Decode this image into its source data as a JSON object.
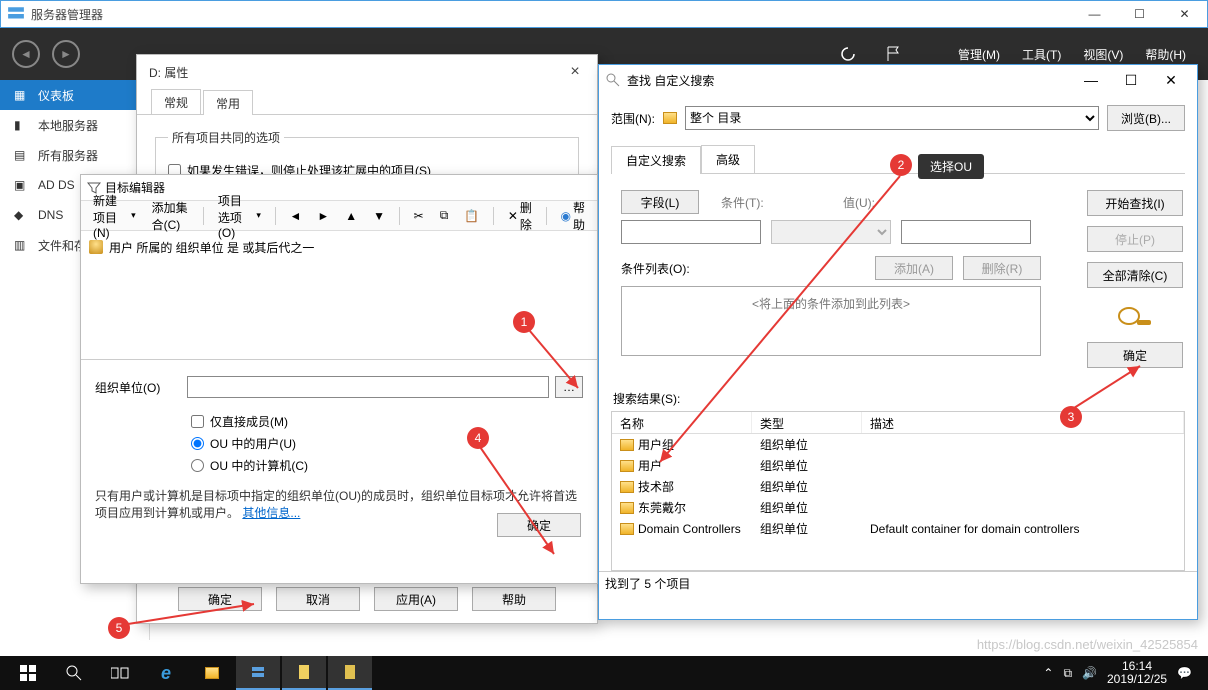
{
  "server_manager": {
    "title": "服务器管理器",
    "menu": {
      "manage": "管理(M)",
      "tools": "工具(T)",
      "view": "视图(V)",
      "help": "帮助(H)"
    },
    "sidebar": {
      "items": [
        {
          "label": "仪表板"
        },
        {
          "label": "本地服务器"
        },
        {
          "label": "所有服务器"
        },
        {
          "label": "AD DS"
        },
        {
          "label": "DNS"
        },
        {
          "label": "文件和存储"
        }
      ]
    }
  },
  "props_dialog": {
    "title": "D: 属性",
    "tabs": {
      "t1": "常规",
      "t2": "常用"
    },
    "group_label": "所有项目共同的选项",
    "checkbox": "如果发生错误，则停止处理该扩展中的项目(S)",
    "buttons": {
      "ok": "确定",
      "cancel": "取消",
      "apply": "应用(A)",
      "help": "帮助"
    }
  },
  "target_editor": {
    "title": "目标编辑器",
    "toolbar": {
      "new_item": "新建项目(N)",
      "add_set": "添加集合(C)",
      "options": "项目选项(O)",
      "delete": "删除",
      "help": "帮助"
    },
    "rule_text": "用户 所属的 组织单位 是  或其后代之一",
    "ou_label": "组织单位(O)",
    "direct_members": "仅直接成员(M)",
    "users_in_ou": "OU 中的用户(U)",
    "computers_in_ou": "OU 中的计算机(C)",
    "note": "只有用户或计算机是目标项中指定的组织单位(OU)的成员时，组织单位目标项才允许将首选项目应用到计算机或用户。",
    "other_info": "其他信息...",
    "ok": "确定"
  },
  "find_dialog": {
    "title": "查找 自定义搜索",
    "scope_label": "范围(N):",
    "scope_value": "整个 目录",
    "browse": "浏览(B)...",
    "tabs": {
      "custom": "自定义搜索",
      "advanced": "高级"
    },
    "field_btn": "字段(L)",
    "cond_label": "条件(T):",
    "value_label": "值(U):",
    "list_label": "条件列表(O):",
    "add": "添加(A)",
    "remove": "删除(R)",
    "placeholder": "<将上面的条件添加到此列表>",
    "start": "开始查找(I)",
    "stop": "停止(P)",
    "clear": "全部清除(C)",
    "ok_btn": "确定",
    "results_label": "搜索结果(S):",
    "columns": {
      "name": "名称",
      "type": "类型",
      "desc": "描述"
    },
    "rows": [
      {
        "name": "用户组",
        "type": "组织单位",
        "desc": ""
      },
      {
        "name": "用户",
        "type": "组织单位",
        "desc": ""
      },
      {
        "name": "技术部",
        "type": "组织单位",
        "desc": ""
      },
      {
        "name": "东莞戴尔",
        "type": "组织单位",
        "desc": ""
      },
      {
        "name": "Domain Controllers",
        "type": "组织单位",
        "desc": "Default container for domain controllers"
      }
    ],
    "status": "找到了 5 个项目"
  },
  "annotations": {
    "select_ou": "选择OU",
    "n1": "1",
    "n2": "2",
    "n3": "3",
    "n4": "4",
    "n5": "5"
  },
  "taskbar": {
    "time": "16:14",
    "date": "2019/12/25"
  },
  "watermark": "https://blog.csdn.net/weixin_42525854"
}
